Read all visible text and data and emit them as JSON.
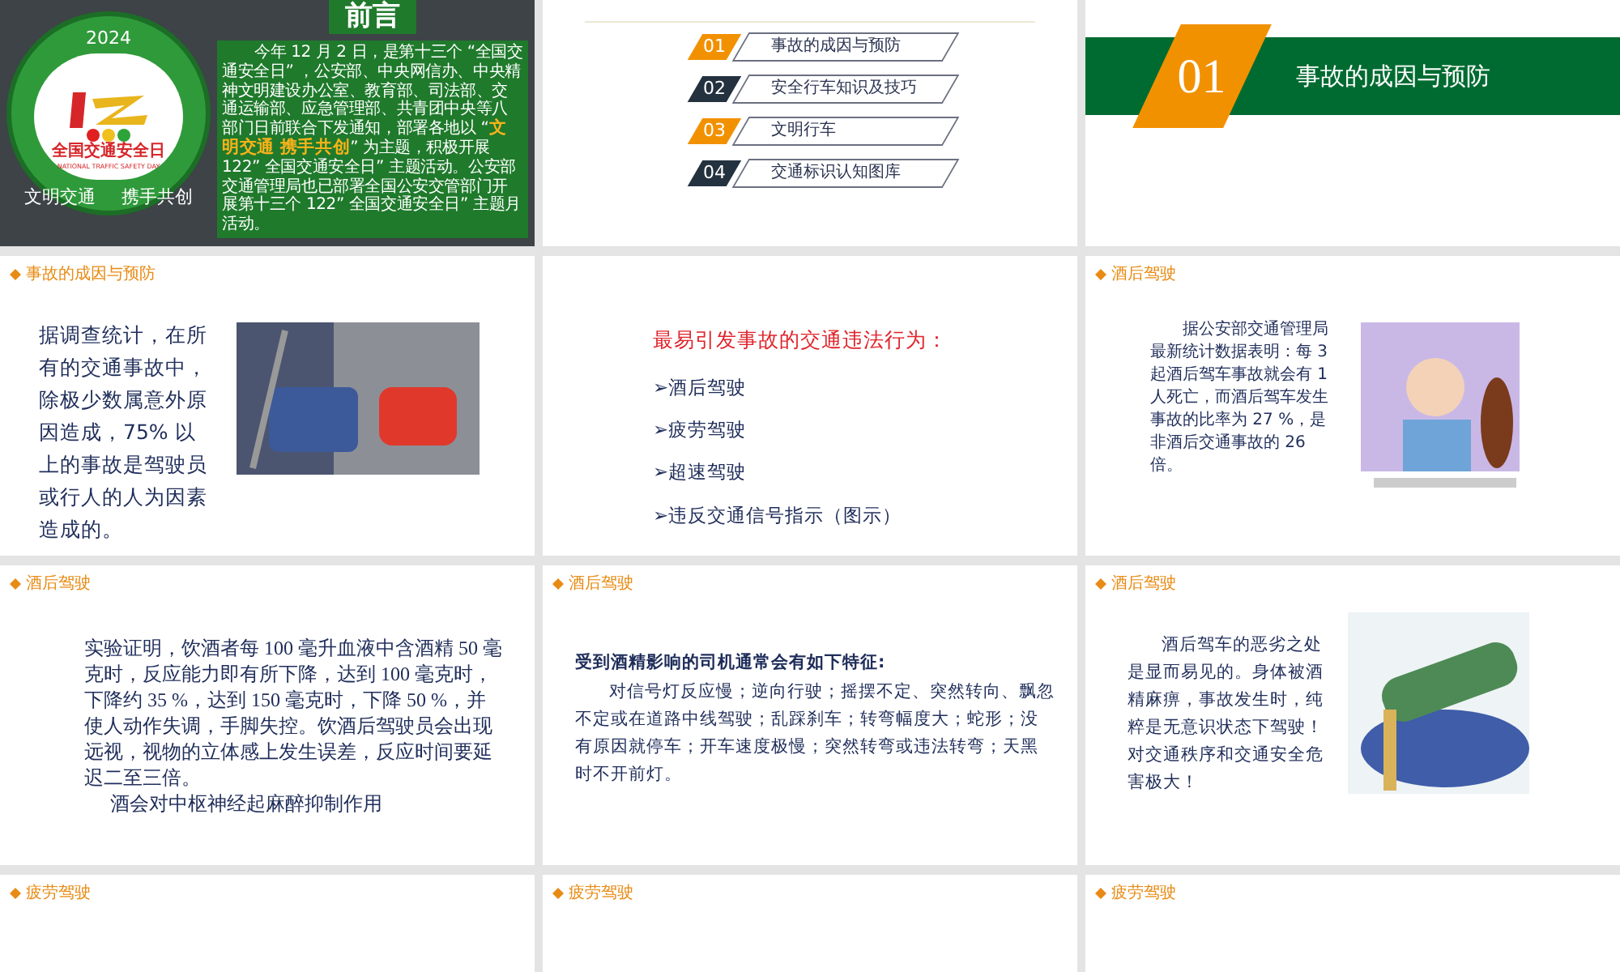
{
  "slides": [
    {
      "kind": "cover",
      "logo": {
        "year": "2024",
        "name": "全国交通安全日",
        "name_en": "NATIONAL TRAFFIC SAFETY DAY",
        "slogan_left": "文明交通",
        "slogan_right": "携手共创"
      },
      "title": "前言",
      "body": "今年 12 月 2 日，是第十三个 “全国交通安全日” ，公安部、中央网信办、中央精神文明建设办公室、教育部、司法部、交通运输部、应急管理部、共青团中央等八部门日前联合下发通知，部署各地以 “**文明交通 携手共创**” 为主题，积极开展 122” 全国交通安全日” 主题活动。公安部交通管理局也已部署全国公安交管部门开展第十三个 122” 全国交通安全日” 主题月活动。"
    },
    {
      "kind": "contents",
      "items": [
        {
          "number": "01",
          "label": "事故的成因与预防",
          "color": "#f29100"
        },
        {
          "number": "02",
          "label": "安全行车知识及技巧",
          "color": "#24313f"
        },
        {
          "number": "03",
          "label": "文明行车",
          "color": "#f29100"
        },
        {
          "number": "04",
          "label": "交通标识认知图库",
          "color": "#24313f"
        }
      ]
    },
    {
      "kind": "section",
      "number": "01",
      "title": "事故的成因与预防"
    },
    {
      "kind": "text_image",
      "tag": "事故的成因与预防",
      "paragraphs": [
        "据调查统计，在所有的交通事故中，除极少数属意外原因造成，75% 以上的事故是驾驶员或行人的人为因素造成的。"
      ]
    },
    {
      "kind": "list",
      "heading": "最易引发事故的交通违法行为：",
      "items": [
        "➢酒后驾驶",
        "➢疲劳驾驶",
        "➢超速驾驶",
        "➢违反交通信号指示（图示）"
      ]
    },
    {
      "kind": "text_image",
      "tag": "酒后驾驶",
      "paragraphs": [
        "据公安部交通管理局最新统计数据表明：每 3 起酒后驾车事故就会有 1 人死亡，而酒后驾车发生事故的比率为 27 %，是非酒后交通事故的 26 倍。"
      ]
    },
    {
      "kind": "text",
      "tag": "酒后驾驶",
      "paragraphs": [
        "实验证明，饮酒者每 100 毫升血液中含酒精 50 毫克时，反应能力即有所下降，达到 100 毫克时，下降约 35 %，达到 150 毫克时，下降 50 %，并使人动作失调，手脚失控。饮酒后驾驶员会出现远视，视物的立体感上发生误差，反应时间要延迟二至三倍。",
        "酒会对中枢神经起麻醉抑制作用"
      ]
    },
    {
      "kind": "text",
      "tag": "酒后驾驶",
      "heading": "受到酒精影响的司机通常会有如下特征:",
      "paragraphs": [
        "对信号灯反应慢；逆向行驶；摇摆不定、突然转向、飘忽不定或在道路中线驾驶；乱踩刹车；转弯幅度大；蛇形；没有原因就停车；开车速度极慢；突然转弯或违法转弯；天黑时不开前灯。"
      ]
    },
    {
      "kind": "text_image",
      "tag": "酒后驾驶",
      "paragraphs": [
        "酒后驾车的恶劣之处是显而易见的。身体被酒精麻痹，事故发生时，纯粹是无意识状态下驾驶！对交通秩序和交通安全危害极大！"
      ]
    },
    {
      "kind": "text",
      "tag": "疲劳驾驶"
    },
    {
      "kind": "text",
      "tag": "疲劳驾驶"
    },
    {
      "kind": "text",
      "tag": "疲劳驾驶"
    }
  ]
}
